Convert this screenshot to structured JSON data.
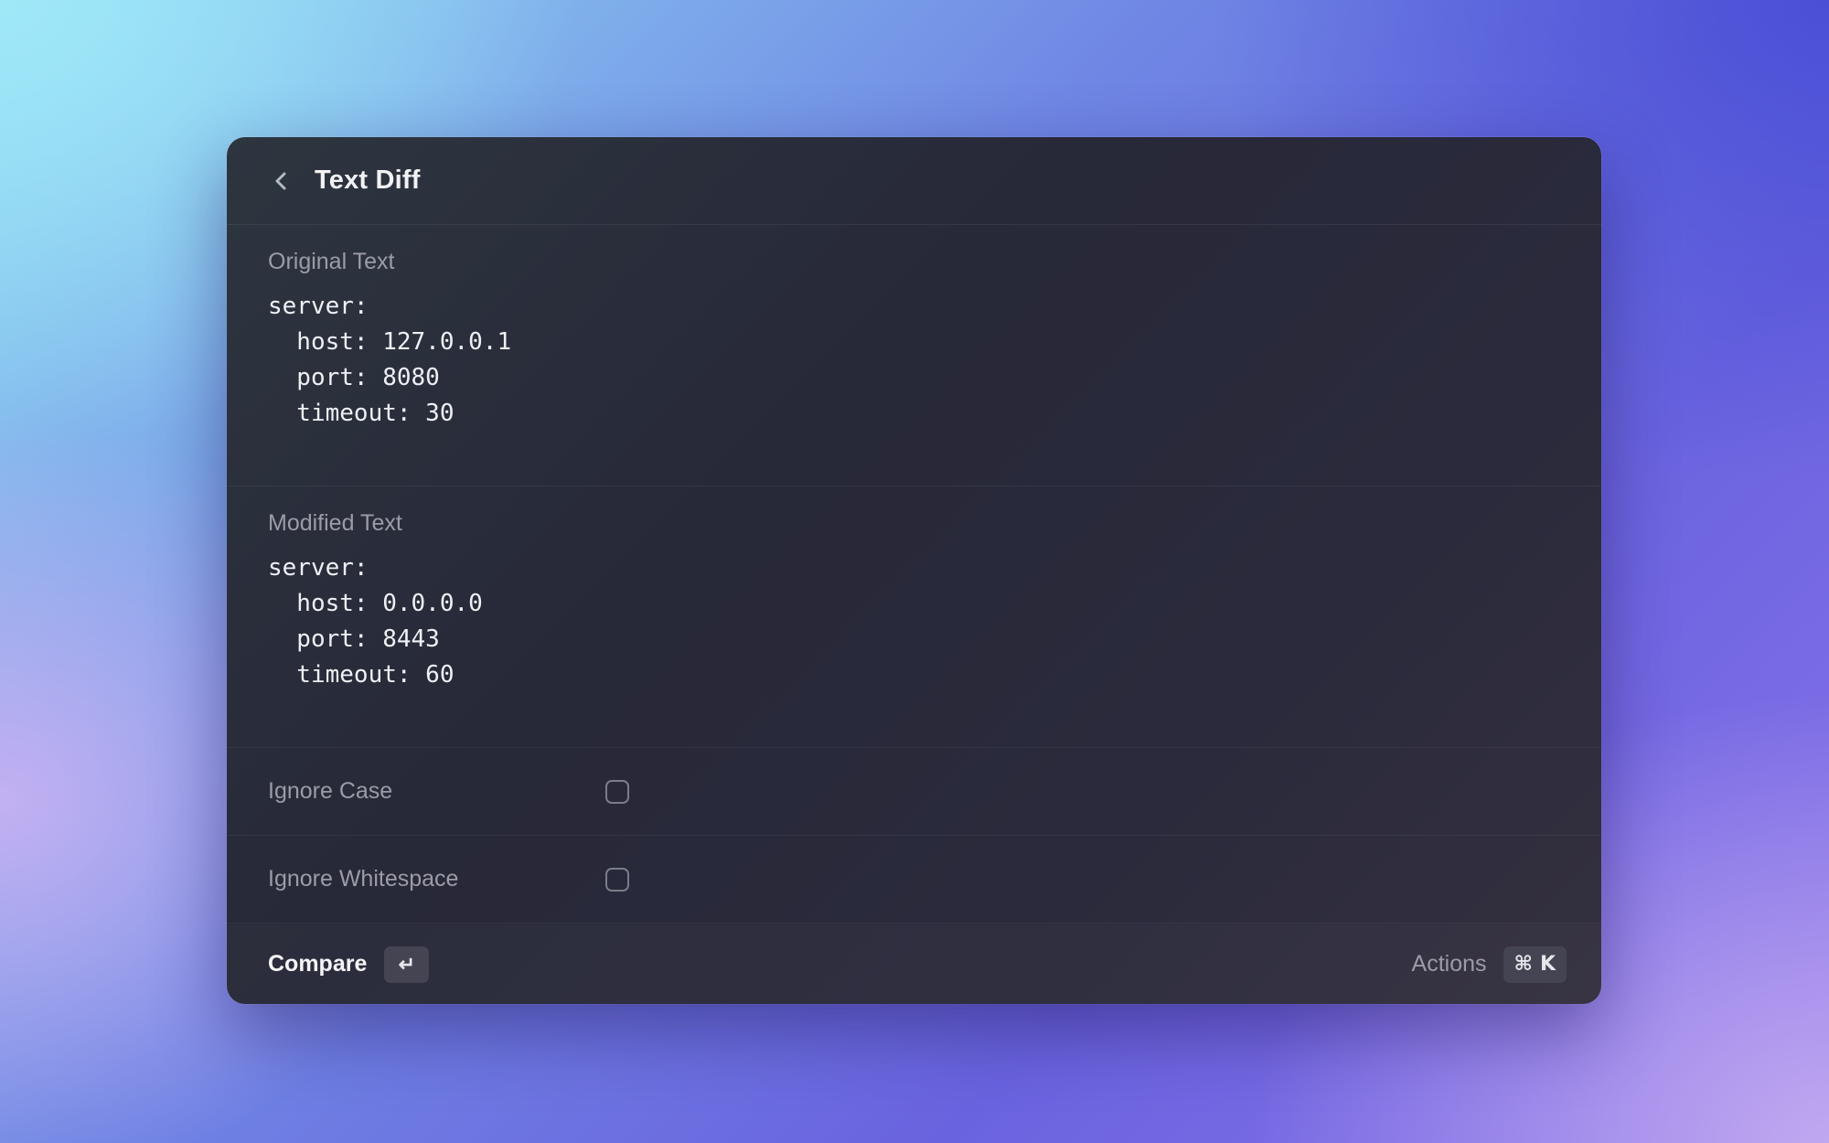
{
  "header": {
    "title": "Text Diff",
    "back_icon": "chevron-left-icon"
  },
  "original": {
    "label": "Original Text",
    "text": "server:\n  host: 127.0.0.1\n  port: 8080\n  timeout: 30"
  },
  "modified": {
    "label": "Modified Text",
    "text": "server:\n  host: 0.0.0.0\n  port: 8443\n  timeout: 60"
  },
  "options": {
    "ignore_case": {
      "label": "Ignore Case",
      "checked": false
    },
    "ignore_whitespace": {
      "label": "Ignore Whitespace",
      "checked": false
    }
  },
  "footer": {
    "primary_label": "Compare",
    "primary_shortcut": "↵",
    "actions_label": "Actions",
    "actions_shortcut_mod": "⌘",
    "actions_shortcut_key": "K"
  }
}
